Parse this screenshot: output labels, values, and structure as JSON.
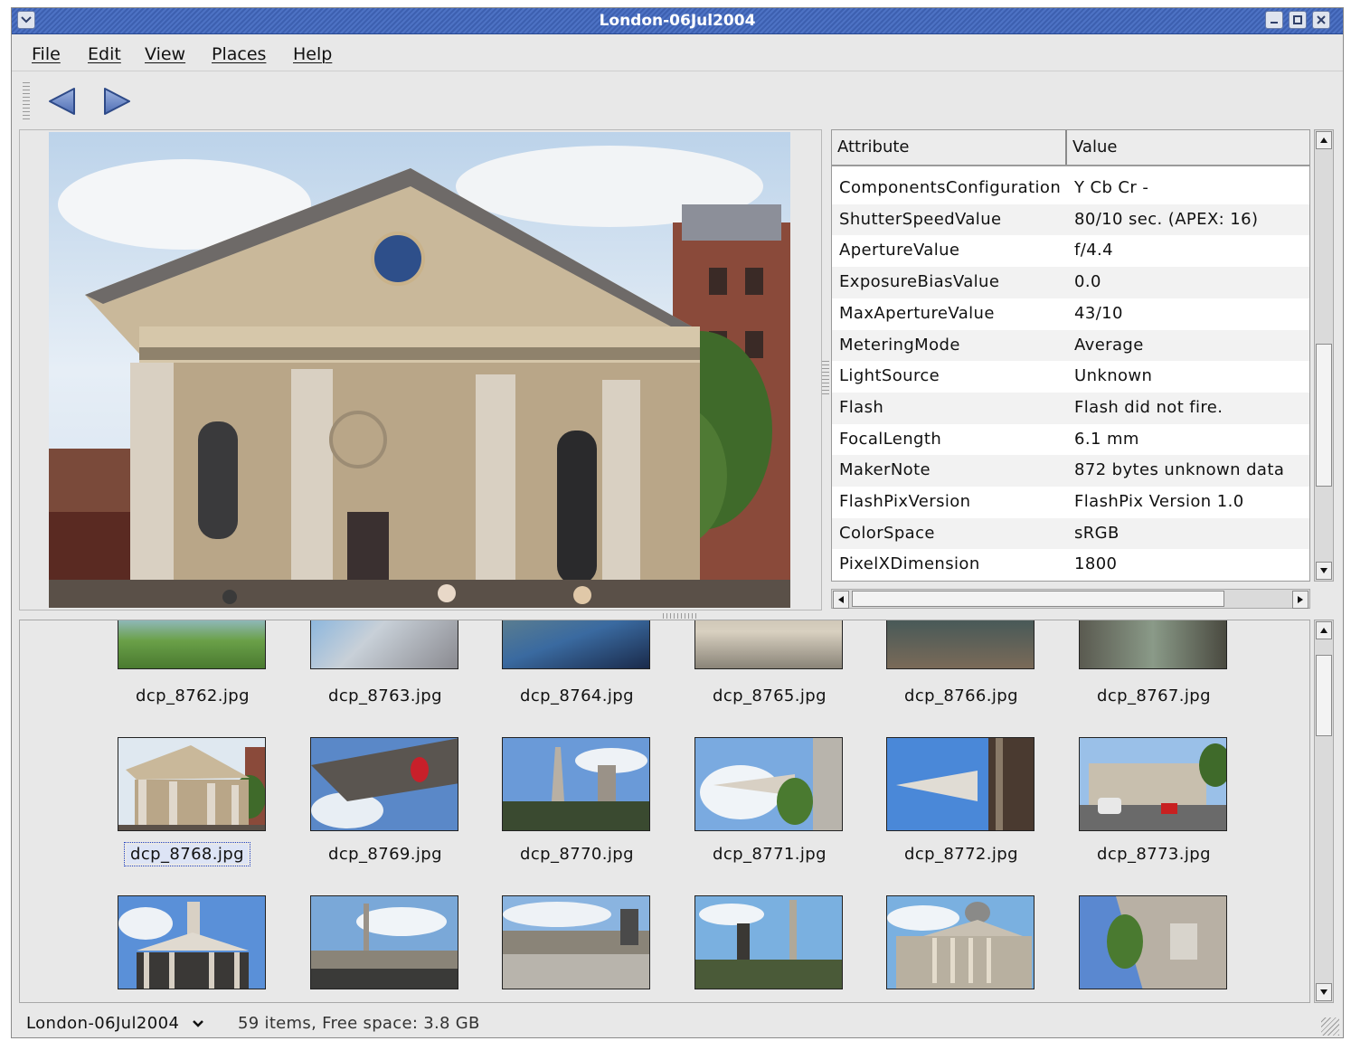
{
  "window": {
    "title": "London-06Jul2004"
  },
  "menu": {
    "file": "File",
    "edit": "Edit",
    "view": "View",
    "places": "Places",
    "help": "Help"
  },
  "toolbar": {
    "back_icon": "triangle-left-icon",
    "forward_icon": "triangle-right-icon"
  },
  "attributes": {
    "col_attribute": "Attribute",
    "col_value": "Value",
    "rows": [
      {
        "name": "ComponentsConfiguration",
        "value": "Y Cb Cr -"
      },
      {
        "name": "ShutterSpeedValue",
        "value": "80/10 sec. (APEX: 16)"
      },
      {
        "name": "ApertureValue",
        "value": "f/4.4"
      },
      {
        "name": "ExposureBiasValue",
        "value": "0.0"
      },
      {
        "name": "MaxApertureValue",
        "value": "43/10"
      },
      {
        "name": "MeteringMode",
        "value": "Average"
      },
      {
        "name": "LightSource",
        "value": "Unknown"
      },
      {
        "name": "Flash",
        "value": "Flash did not fire."
      },
      {
        "name": "FocalLength",
        "value": "6.1 mm"
      },
      {
        "name": "MakerNote",
        "value": "872 bytes unknown data"
      },
      {
        "name": "FlashPixVersion",
        "value": "FlashPix Version 1.0"
      },
      {
        "name": "ColorSpace",
        "value": "sRGB"
      },
      {
        "name": "PixelXDimension",
        "value": "1800"
      }
    ]
  },
  "gallery": {
    "row1": [
      "dcp_8762.jpg",
      "dcp_8763.jpg",
      "dcp_8764.jpg",
      "dcp_8765.jpg",
      "dcp_8766.jpg",
      "dcp_8767.jpg"
    ],
    "row2": [
      "dcp_8768.jpg",
      "dcp_8769.jpg",
      "dcp_8770.jpg",
      "dcp_8771.jpg",
      "dcp_8772.jpg",
      "dcp_8773.jpg"
    ],
    "selected": "dcp_8768.jpg"
  },
  "status": {
    "location": "London-06Jul2004",
    "info": "59 items, Free space: 3.8 GB"
  },
  "colors": {
    "titlebar": "#3d60b0",
    "selection": "#1f3fbf"
  }
}
